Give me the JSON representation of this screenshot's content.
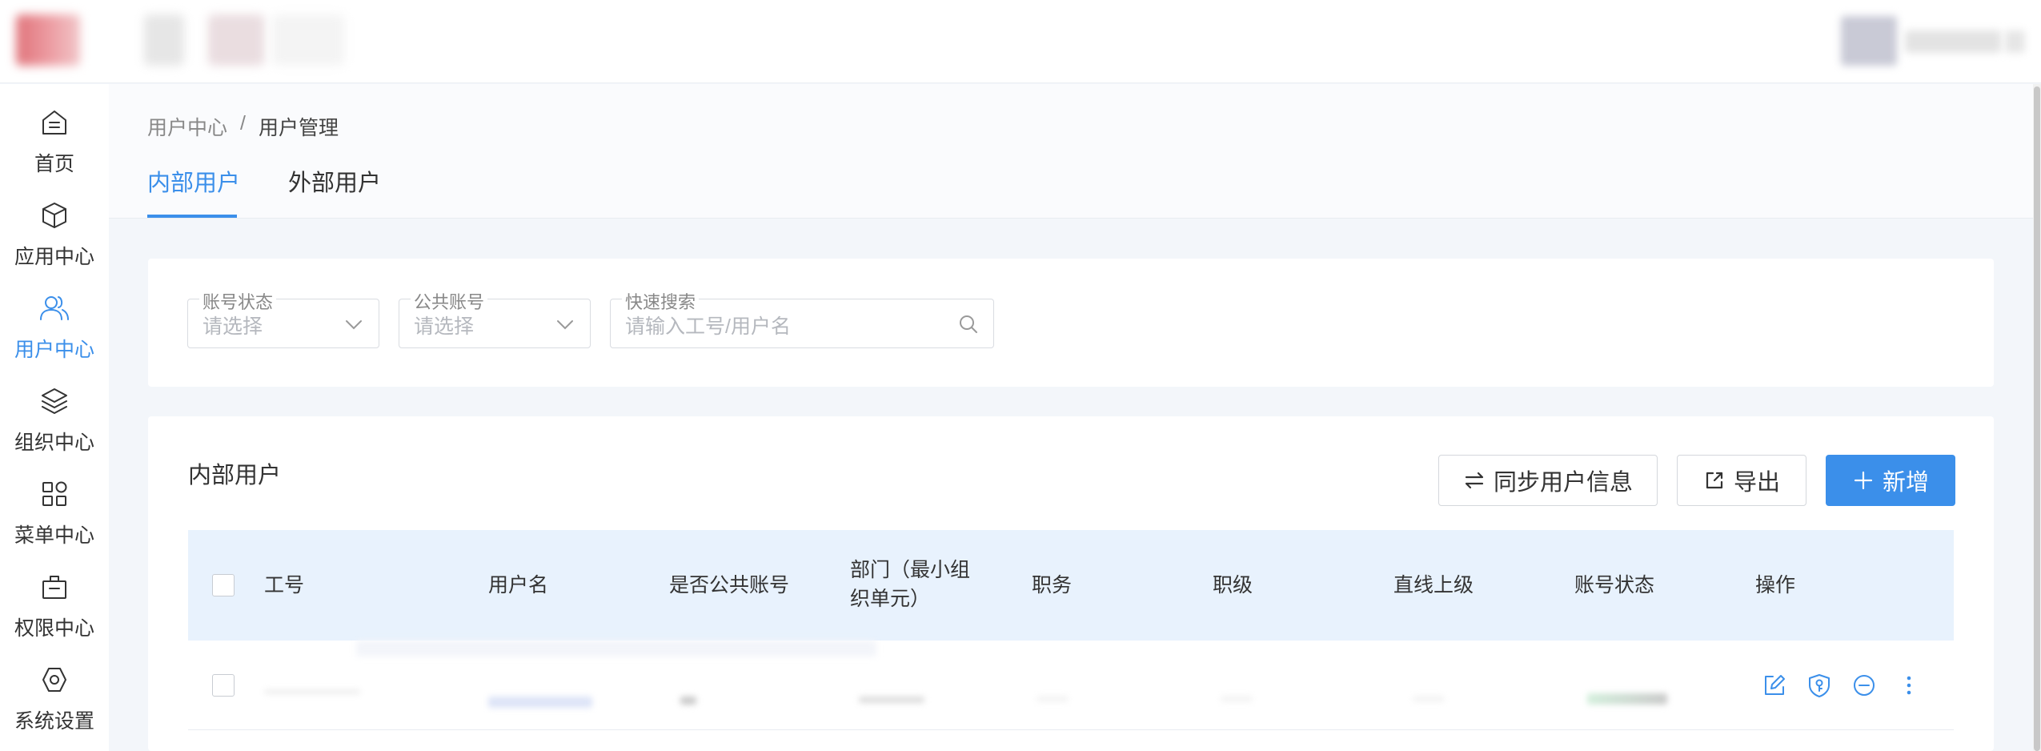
{
  "sidebar": {
    "items": [
      {
        "label": "首页",
        "icon": "home-icon"
      },
      {
        "label": "应用中心",
        "icon": "cube-icon"
      },
      {
        "label": "用户中心",
        "icon": "users-icon"
      },
      {
        "label": "组织中心",
        "icon": "layers-icon"
      },
      {
        "label": "菜单中心",
        "icon": "grid-icon"
      },
      {
        "label": "权限中心",
        "icon": "briefcase-icon"
      },
      {
        "label": "系统设置",
        "icon": "hexagon-settings-icon"
      }
    ],
    "active_index": 2
  },
  "breadcrumb": {
    "root": "用户中心",
    "separator": "/",
    "current": "用户管理"
  },
  "tabs": [
    {
      "label": "内部用户"
    },
    {
      "label": "外部用户"
    }
  ],
  "filters": {
    "account_status": {
      "label": "账号状态",
      "placeholder": "请选择"
    },
    "public_account": {
      "label": "公共账号",
      "placeholder": "请选择"
    },
    "quick_search": {
      "label": "快速搜索",
      "placeholder": "请输入工号/用户名"
    }
  },
  "table_card": {
    "title": "内部用户",
    "buttons": {
      "sync": "同步用户信息",
      "export": "导出",
      "add": "新增"
    },
    "columns": [
      "工号",
      "用户名",
      "是否公共账号",
      "部门（最小组织单元）",
      "职务",
      "职级",
      "直线上级",
      "账号状态",
      "操作"
    ],
    "column_dept_lines": [
      "部门（最小组",
      "织单元）"
    ]
  },
  "colors": {
    "accent": "#3b8fea",
    "header_bg": "#e8f2fd",
    "page_bg": "#f3f6fa"
  }
}
